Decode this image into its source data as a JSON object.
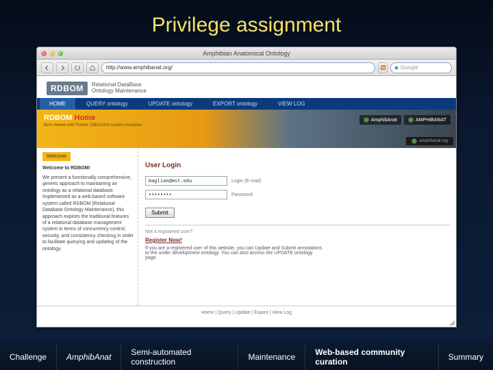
{
  "slide_title": "Privilege assignment",
  "browser": {
    "window_title": "Amphibian Anatomical Ontology",
    "url": "http://www.amphibanat.org/",
    "search_placeholder": "Google"
  },
  "rdbom": {
    "mark": "RDBOM",
    "tagline1": "Relational DataBase",
    "tagline2": "Ontology Maintenance"
  },
  "nav": {
    "home": "HOME",
    "query": "QUERY ontology",
    "update": "UPDATE ontology",
    "export": "EXPORT ontology",
    "viewlog": "VIEW LOG"
  },
  "banner": {
    "heading_prefix": "RDBOM",
    "heading_suffix": "Home",
    "sub": "Best viewed with Firefox\n1280x1024 screen resolution",
    "brand1": "AmphibAnat",
    "brand2": "AMPHIBANAT",
    "brand_bar": "amphibanat.org"
  },
  "sidebar": {
    "tab": "Welcome",
    "welcome_heading": "Welcome to RDBOM!",
    "p1": "We present a functionally comprehensive, generic approach to maintaining an ontology as a relational database. Implemented as a web-based software system called RDBOM (Relational Database Ontology Maintenance), this approach exploits the traditional features of a relational database management system in terms of concurrency control, security, and consistency checking in order to facilitate querying and updating of the ontology."
  },
  "login": {
    "heading": "User Login",
    "email_value": "maglian@mst.edu",
    "email_label": "Login (E-mail)",
    "password_mask": "••••••••",
    "password_label": "Password",
    "submit": "Submit",
    "not_registered": "Not a registered user?",
    "register_now": "Register Now!",
    "note": "If you are a registered user of this website, you can Update and Submit annotations to the under development ontology. You can also access the UPDATE ontology page."
  },
  "page_footer": "Home | Query | Update | Export | View Log",
  "bottom_nav": {
    "challenge": "Challenge",
    "amphibanat": "AmphibAnat",
    "semi": "Semi-automated construction",
    "maint": "Maintenance",
    "web": "Web-based community curation",
    "summary": "Summary"
  }
}
